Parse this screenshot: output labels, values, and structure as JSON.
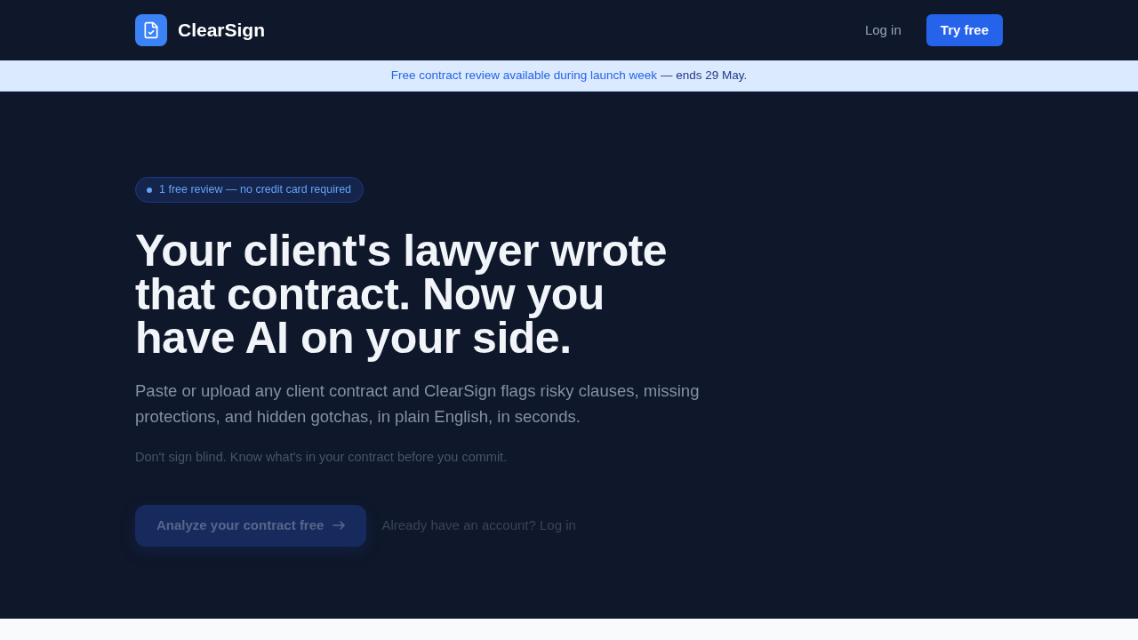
{
  "header": {
    "brand": "ClearSign",
    "nav": [
      {
        "label": "Log in",
        "kind": "link"
      },
      {
        "label": "Try free",
        "kind": "button"
      }
    ]
  },
  "announcement": {
    "highlight": "Free contract review available during launch week",
    "text": "— ends 29 May."
  },
  "hero": {
    "badge": "1 free review — no credit card required",
    "heading": "Your client's lawyer wrote that contract. Now you have AI on your side.",
    "description": "Paste or upload any client contract and ClearSign flags risky clauses, missing protections, and hidden gotchas, in plain English, in seconds.",
    "note": "Don't sign blind. Know what's in your contract before you commit.",
    "cta": "Analyze your contract free",
    "secondary_link": "Already have an account? Log in"
  }
}
